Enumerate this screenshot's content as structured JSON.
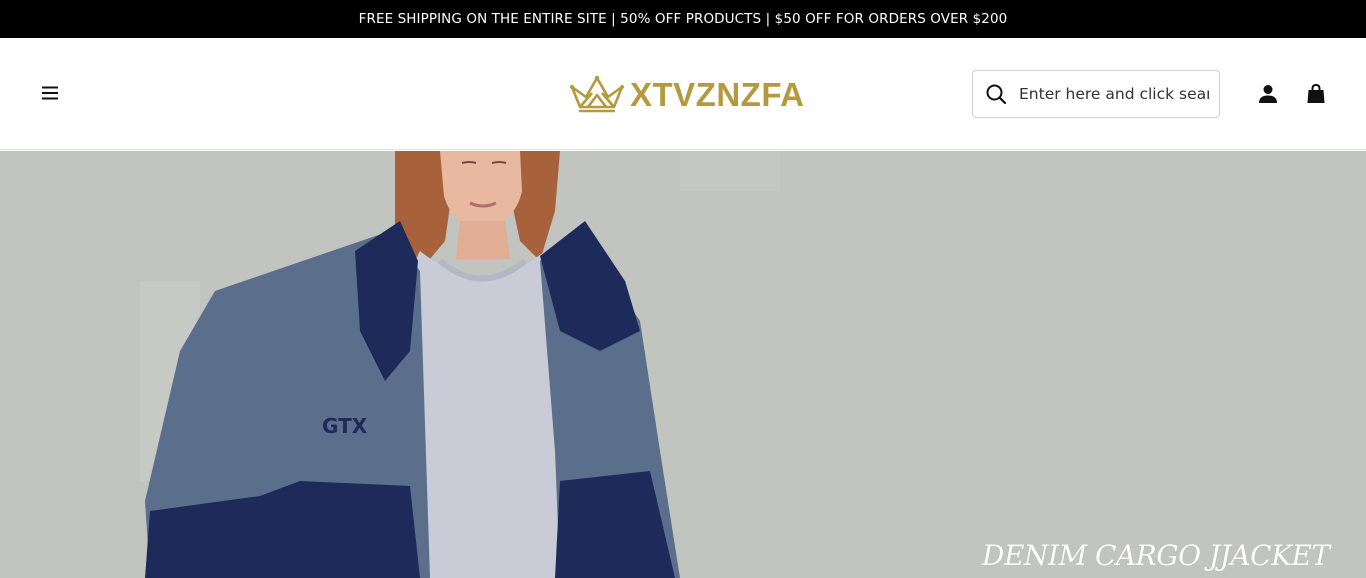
{
  "announcement": {
    "text": "FREE SHIPPING ON THE ENTIRE SITE | 50% OFF PRODUCTS | $50 OFF FOR ORDERS OVER $200"
  },
  "header": {
    "menu_icon": "hamburger-menu-icon",
    "logo_text": "XTVZNZFA",
    "logo_icon": "crown-icon",
    "search": {
      "placeholder": "Enter here and click search",
      "value": "",
      "icon": "search-icon"
    },
    "account_icon": "user-icon",
    "cart_icon": "shopping-bag-icon"
  },
  "hero": {
    "title": "DENIM CARGO JJACKET",
    "image_icon": "model-fleece-jacket-photo"
  },
  "colors": {
    "announcement_bg": "#000000",
    "logo_gold": "#b49a3c",
    "hero_bg": "#c1c4bf",
    "jacket_gray": "#5b6f8c",
    "jacket_navy": "#1e2a5a"
  }
}
